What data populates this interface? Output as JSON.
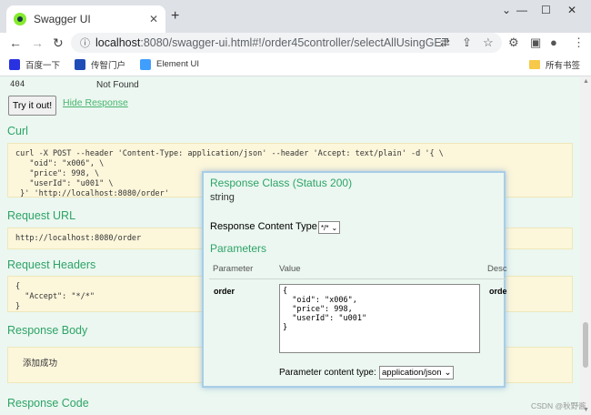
{
  "browser": {
    "tab_title": "Swagger UI",
    "url_host": "localhost",
    "url_rest": ":8080/swagger-ui.html#!/order45controller/selectAllUsingGET",
    "bookmarks": [
      "百度一下",
      "传智门户",
      "Element UI"
    ],
    "bookmarks_folder": "所有书签"
  },
  "response_row": {
    "code": "404",
    "reason": "Not Found"
  },
  "try_button": "Try it out!",
  "hide_response": "Hide Response",
  "sections": {
    "curl": "Curl",
    "request_url": "Request URL",
    "request_headers": "Request Headers",
    "response_body": "Response Body",
    "response_code": "Response Code"
  },
  "curl_text": "curl -X POST --header 'Content-Type: application/json' --header 'Accept: text/plain' -d '{ \\\n   \"oid\": \"x006\", \\\n   \"price\": 998, \\\n   \"userId\": \"u001\" \\\n }' 'http://localhost:8080/order'",
  "request_url_text": "http://localhost:8080/order",
  "request_headers_text": "{\n  \"Accept\": \"*/*\"\n}",
  "response_body_text": "添加成功",
  "popup": {
    "response_class": "Response Class (Status 200)",
    "response_type": "string",
    "content_type_label": "Response Content Type",
    "content_type_value": "*/*",
    "parameters_title": "Parameters",
    "col_parameter": "Parameter",
    "col_value": "Value",
    "col_desc": "Desc",
    "param_name": "order",
    "param_name_trunc": "orde",
    "param_value": "{\n  \"oid\": \"x006\",\n  \"price\": 998,\n  \"userId\": \"u001\"\n}",
    "param_content_type_label": "Parameter content type:",
    "param_content_type_value": "application/json"
  },
  "watermark": "CSDN @秋野酱"
}
